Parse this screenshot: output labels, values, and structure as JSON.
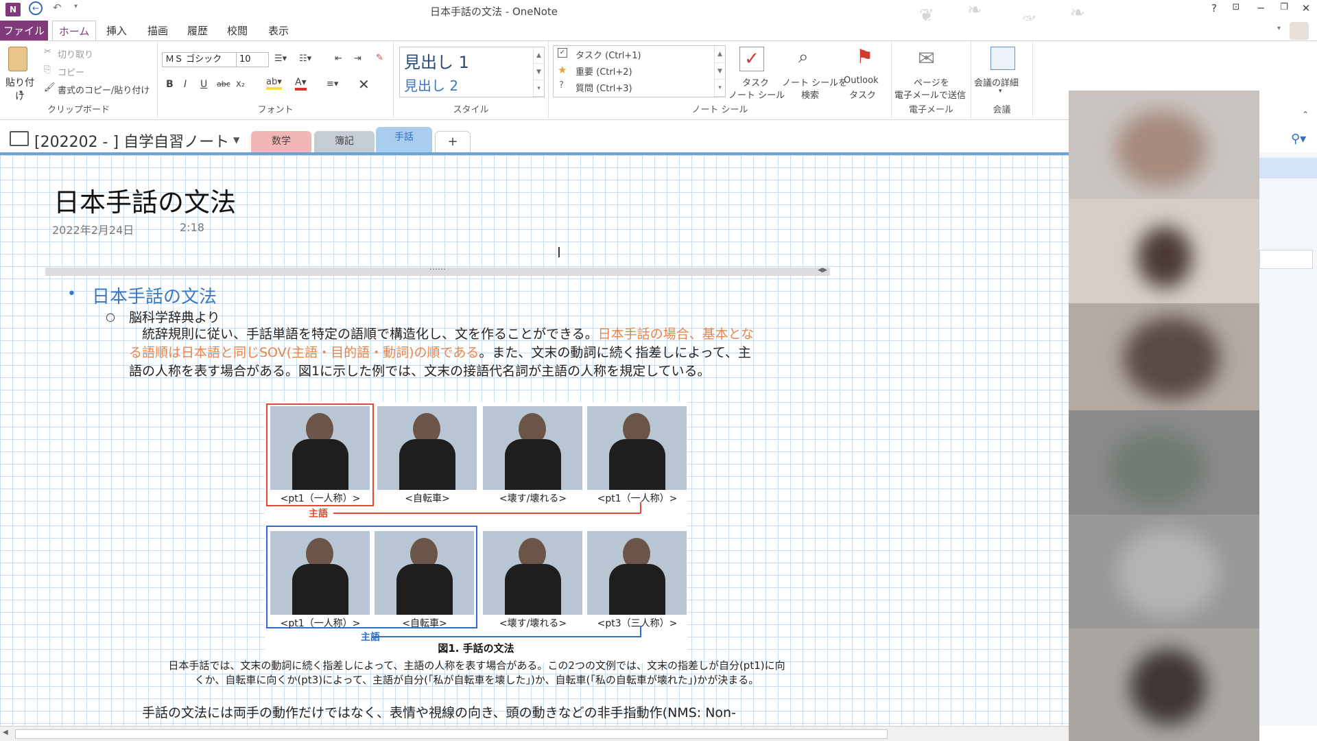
{
  "window": {
    "title": "日本手話の文法 - OneNote",
    "help": "?",
    "controls": [
      "ribbon-toggle",
      "minimize",
      "restore",
      "close"
    ]
  },
  "menu": {
    "file": "ファイル",
    "tabs": [
      "ホーム",
      "挿入",
      "描画",
      "履歴",
      "校閲",
      "表示"
    ],
    "active_tab": "ホーム"
  },
  "ribbon": {
    "clipboard": {
      "label": "クリップボード",
      "paste": "貼り付け",
      "cut": "切り取り",
      "copy": "コピー",
      "format_painter": "書式のコピー/貼り付け"
    },
    "font": {
      "label": "フォント",
      "family": "ＭＳ ゴシック",
      "size": "10",
      "bold": "B",
      "italic": "I",
      "underline": "U",
      "strike": "abc",
      "subscript": "x₂"
    },
    "styles": {
      "label": "スタイル",
      "heading1": "見出し 1",
      "heading2": "見出し 2"
    },
    "tags": {
      "label": "ノート シール",
      "items": [
        "タスク (Ctrl+1)",
        "重要 (Ctrl+2)",
        "質問 (Ctrl+3)"
      ],
      "task_tag": "タスク",
      "task_tag2": "ノート シール",
      "find_tags": "ノート シールを",
      "find_tags2": "検索",
      "outlook": "Outlook",
      "outlook2": "タスク"
    },
    "email": {
      "label": "電子メール",
      "send": "ページを",
      "send2": "電子メールで送信"
    },
    "meetings": {
      "label": "会議",
      "details": "会議の詳細"
    }
  },
  "notebook": {
    "name": "[202202 - ] 自学自習ノート",
    "sections": [
      {
        "label": "数学",
        "color": "#f2b6b6"
      },
      {
        "label": "簿記",
        "color": "#c6ccd4"
      },
      {
        "label": "手話",
        "color": "#a9cdef"
      }
    ],
    "add_section": "+"
  },
  "page": {
    "title": "日本手話の文法",
    "date": "2022年2月24日",
    "time": "2:18",
    "heading": "日本手話の文法",
    "source": "脳科学辞典より",
    "para_line1_a": "　統辞規則に従い、手話単語を特定の語順で構造化し、文を作ることができる。",
    "para_line1_b": "日本手話の場合、基本とな",
    "para_line2_a": "る語順は日本語と同じSOV(主語・目的語・動詞)の順である",
    "para_line2_b": "。また、文末の動詞に続く指差しによって、主",
    "para_line3": "語の人称を表す場合がある。図1に示した例では、文末の接語代名詞が主語の人称を規定している。",
    "figure": {
      "row1": [
        "<pt1（一人称）>",
        "<自転車>",
        "<壊す/壊れる>",
        "<pt1（一人称）>"
      ],
      "row2": [
        "<pt1（一人称）>",
        "<自転車>",
        "<壊す/壊れる>",
        "<pt3（三人称）>"
      ],
      "subject": "主語",
      "title": "図1. 手話の文法"
    },
    "caption_line1": "日本手話では、文末の動詞に続く指差しによって、主語の人称を表す場合がある。この2つの文例では、文末の指差しが自分(pt1)に向",
    "caption_line2": "くか、自転車に向くか(pt3)によって、主語が自分(「私が自転車を壊した」)か、自転車(「私の自転車が壊れた」)かが決まる。",
    "para2_line1": "　手話の文法には両手の動作だけではなく、表情や視線の向き、頭の動きなどの非手指動作(NMS: Non-"
  }
}
